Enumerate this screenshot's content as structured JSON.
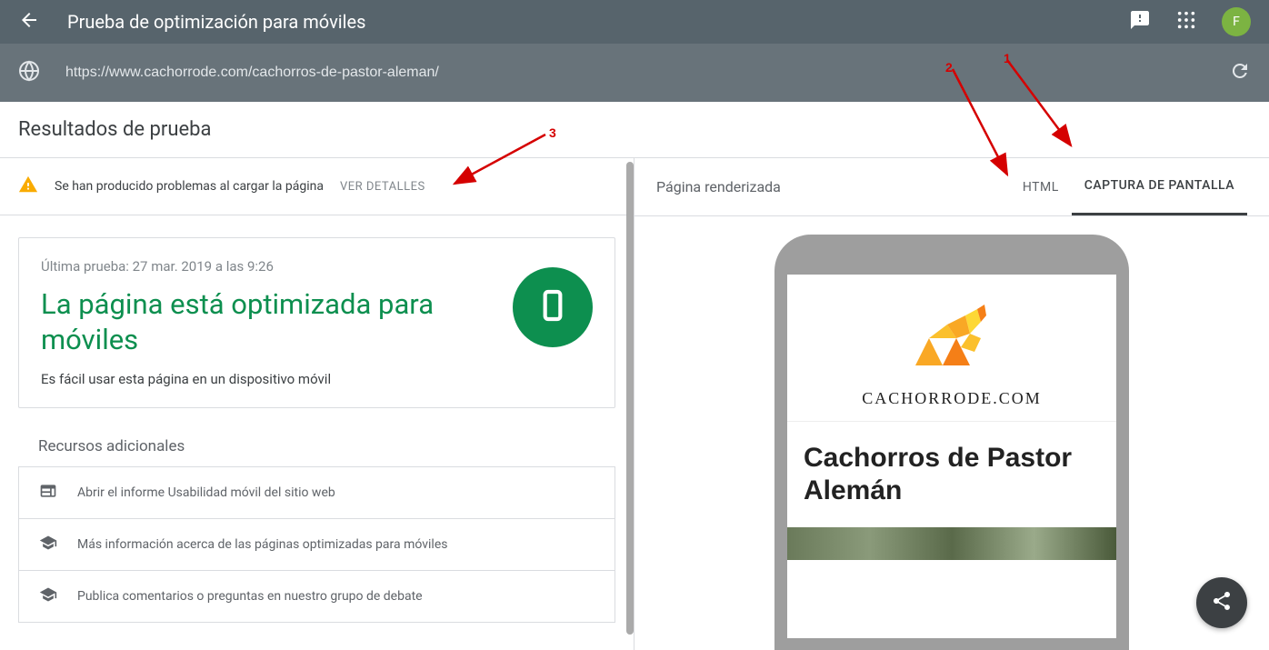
{
  "header": {
    "title": "Prueba de optimización para móviles",
    "avatar_initial": "F"
  },
  "url_bar": {
    "url": "https://www.cachorrode.com/cachorros-de-pastor-aleman/"
  },
  "section_title": "Resultados de prueba",
  "warning": {
    "text": "Se han producido problemas al cargar la página",
    "action": "VER DETALLES"
  },
  "result": {
    "last_test": "Última prueba: 27 mar. 2019 a las 9:26",
    "headline": "La página está optimizada para móviles",
    "subtext": "Es fácil usar esta página en un dispositivo móvil"
  },
  "resources": {
    "title": "Recursos adicionales",
    "items": [
      "Abrir el informe Usabilidad móvil del sitio web",
      "Más información acerca de las páginas optimizadas para móviles",
      "Publica comentarios o preguntas en nuestro grupo de debate"
    ]
  },
  "right": {
    "title": "Página renderizada",
    "tabs": {
      "html": "HTML",
      "screenshot": "CAPTURA DE PANTALLA"
    }
  },
  "preview": {
    "logo_caption": "CACHORRODE.COM",
    "article_title": "Cachorros de Pastor Alemán"
  },
  "annotations": {
    "a1": "1",
    "a2": "2",
    "a3": "3"
  },
  "colors": {
    "success": "#0d8f4f",
    "header_bg": "#57646c",
    "urlbar_bg": "#68737a",
    "accent_red": "#d50000"
  }
}
